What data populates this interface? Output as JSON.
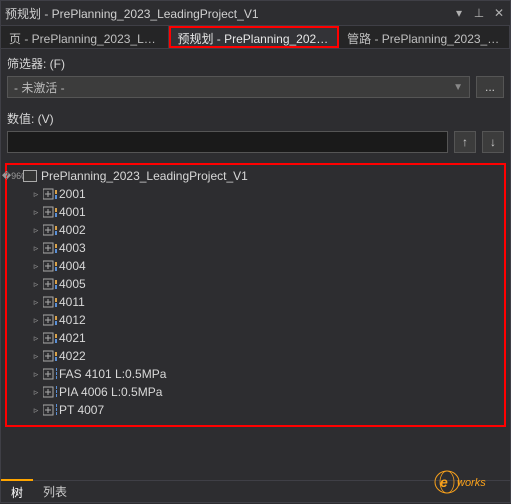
{
  "titlebar": {
    "title": "预规划 - PrePlanning_2023_LeadingProject_V1"
  },
  "tabs": [
    {
      "label": "页 - PrePlanning_2023_Leadi...",
      "active": false,
      "hl": false
    },
    {
      "label": "预规划 - PrePlanning_2023_L...",
      "active": true,
      "hl": true
    },
    {
      "label": "管路 - PrePlanning_2023_Lea...",
      "active": false,
      "hl": false
    }
  ],
  "filter": {
    "section": "筛选器: (F)",
    "value": "- 未激活 -",
    "more": "..."
  },
  "valuebox": {
    "section": "数值: (V)",
    "value": ""
  },
  "tree": {
    "root": "PrePlanning_2023_LeadingProject_V1",
    "nodes": [
      {
        "label": "2001",
        "icon": "block"
      },
      {
        "label": "4001",
        "icon": "block"
      },
      {
        "label": "4002",
        "icon": "block"
      },
      {
        "label": "4003",
        "icon": "block"
      },
      {
        "label": "4004",
        "icon": "block"
      },
      {
        "label": "4005",
        "icon": "block"
      },
      {
        "label": "4011",
        "icon": "block"
      },
      {
        "label": "4012",
        "icon": "block"
      },
      {
        "label": "4021",
        "icon": "block"
      },
      {
        "label": "4022",
        "icon": "block"
      },
      {
        "label": "FAS 4101 L:0.5MPa",
        "icon": "pipe"
      },
      {
        "label": "PIA 4006 L:0.5MPa",
        "icon": "pipe"
      },
      {
        "label": "PT 4007",
        "icon": "pipe"
      }
    ]
  },
  "footer": {
    "tab1": "树",
    "tab2": "列表"
  },
  "logo": {
    "text1": "e",
    "text2": "works"
  }
}
